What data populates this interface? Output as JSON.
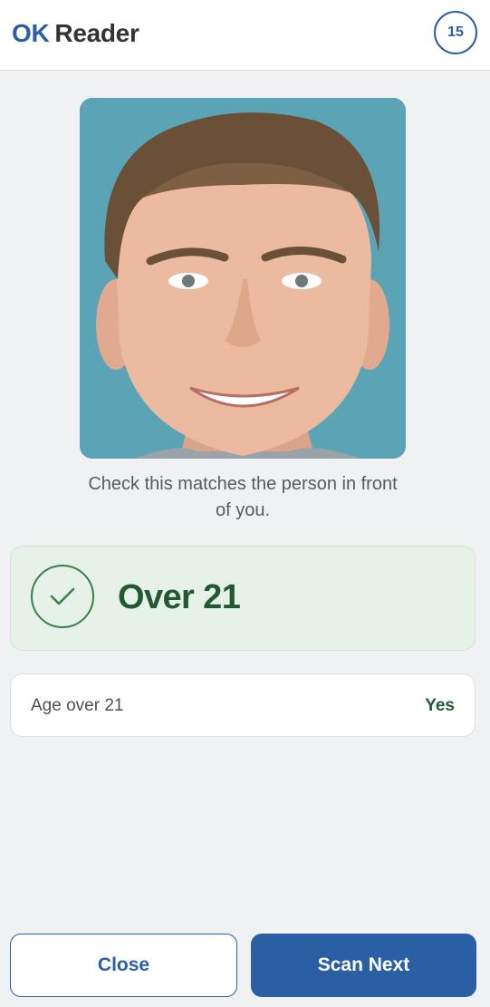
{
  "header": {
    "brand_ok": "OK",
    "brand_reader": "Reader",
    "scan_count": "15"
  },
  "photo": {
    "icon": "person-portrait-photo",
    "background_color": "#5aa4b6"
  },
  "instruction": "Check this matches the person in front of you.",
  "result": {
    "icon": "check-icon",
    "title": "Over 21",
    "color": "#235932",
    "background_color": "#e6f1e8"
  },
  "details": [
    {
      "label": "Age over 21",
      "value": "Yes"
    }
  ],
  "actions": {
    "close_label": "Close",
    "scan_next_label": "Scan Next",
    "accent_color": "#2a5fa3"
  }
}
